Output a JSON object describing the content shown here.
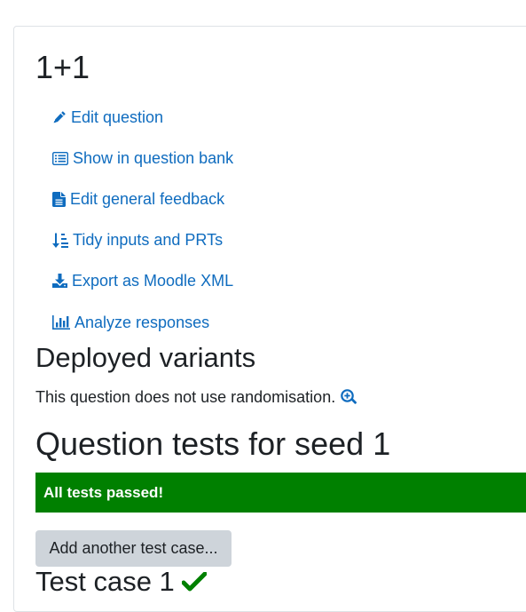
{
  "question": {
    "title": "1+1"
  },
  "actions": [
    {
      "label": "Edit question",
      "icon": "pencil-icon"
    },
    {
      "label": "Show in question bank",
      "icon": "list-icon"
    },
    {
      "label": "Edit general feedback",
      "icon": "file-text-icon"
    },
    {
      "label": "Tidy inputs and PRTs",
      "icon": "sort-numeric-icon"
    },
    {
      "label": "Export as Moodle XML",
      "icon": "download-icon"
    },
    {
      "label": "Analyze responses",
      "icon": "bar-chart-icon"
    }
  ],
  "deployed": {
    "heading": "Deployed variants",
    "message": "This question does not use randomisation."
  },
  "tests": {
    "heading": "Question tests for seed 1",
    "status": "All tests passed!",
    "add_button": "Add another test case...",
    "case_heading": "Test case 1"
  },
  "colors": {
    "link": "#0f6cbf",
    "success": "#008000",
    "button_bg": "#ced4da",
    "text": "#1d2125"
  }
}
